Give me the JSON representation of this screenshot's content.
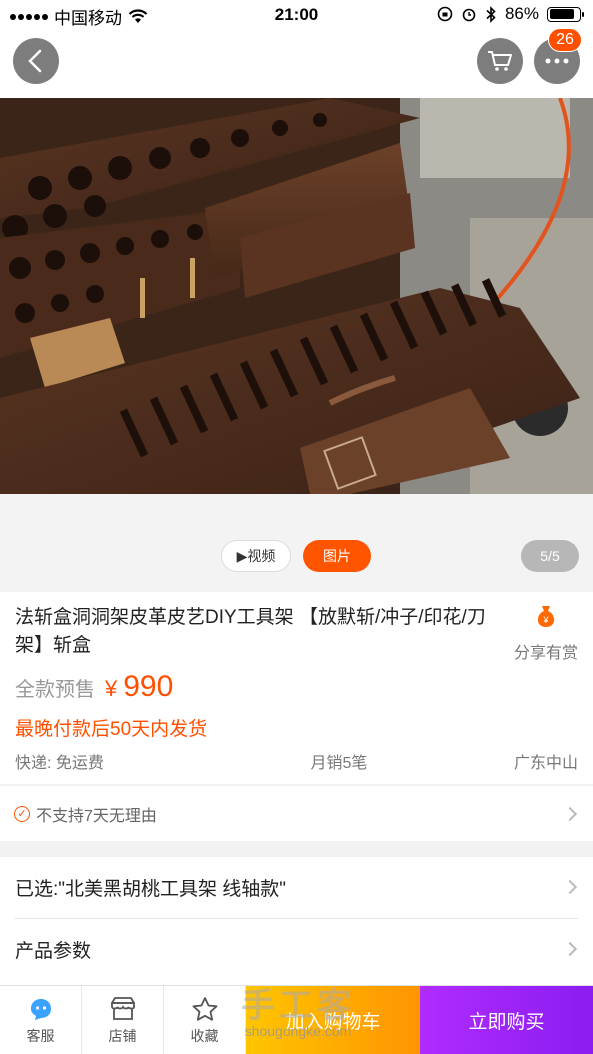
{
  "status_bar": {
    "carrier": "中国移动",
    "time": "21:00",
    "battery_text": "86%",
    "battery_level": 0.86
  },
  "header": {
    "cart_badge": "26",
    "icons": [
      "back-icon",
      "cart-icon",
      "more-icon"
    ]
  },
  "gallery": {
    "video_label": "▶视频",
    "photo_label": "图片",
    "counter": "5/5"
  },
  "product": {
    "title": "法斩盒洞洞架皮革皮艺DIY工具架 【放默斩/冲子/印花/刀架】斩盒",
    "share_label": "分享有赏",
    "presale_label": "全款预售",
    "currency": "¥",
    "price": "990",
    "ship_note": "最晚付款后50天内发货",
    "shipping": "快递: 免运费",
    "monthly_sales": "月销5笔",
    "location": "广东中山"
  },
  "service": {
    "text": "不支持7天无理由"
  },
  "options": {
    "selected": "已选:\"北美黑胡桃工具架 线轴款\"",
    "params": "产品参数"
  },
  "bottom_bar": {
    "service_label": "客服",
    "store_label": "店铺",
    "favorite_label": "收藏",
    "add_cart_label": "加入购物车",
    "buy_now_label": "立即购买"
  },
  "watermark": {
    "cn": "手工客",
    "en": "shougongke.com"
  },
  "colors": {
    "accent": "#ff5000",
    "cart_button": "#ff9402",
    "buy_button": "#a020f0"
  }
}
